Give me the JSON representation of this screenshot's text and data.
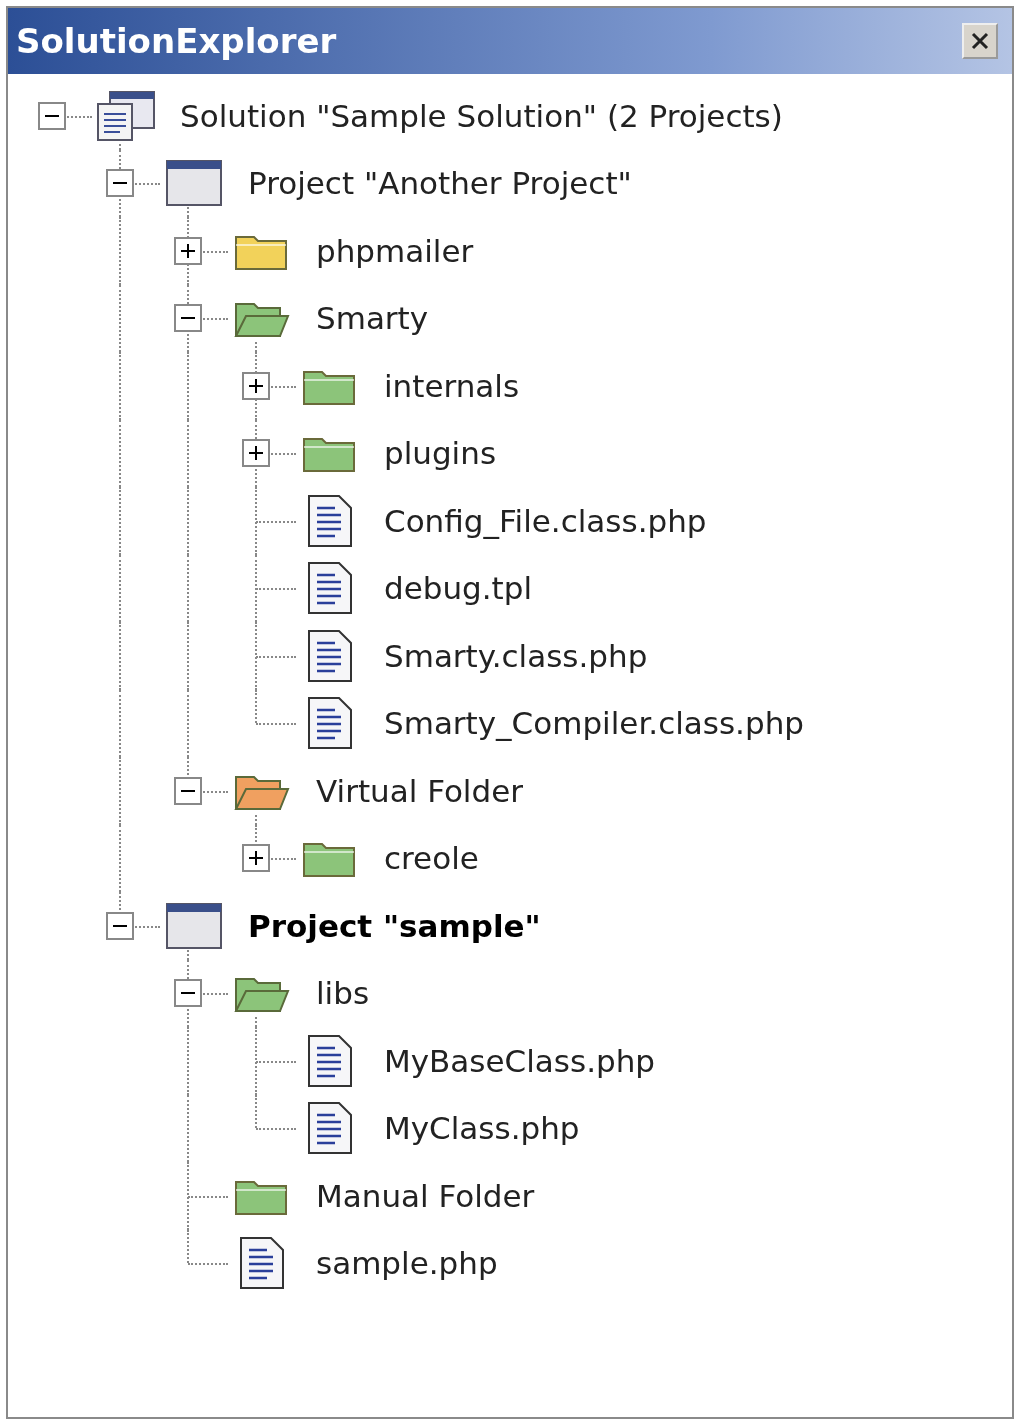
{
  "window": {
    "title": "SolutionExplorer"
  },
  "tree": [
    {
      "kind": "solution",
      "label": "Solution \"Sample Solution\" (2 Projects)",
      "expanded": true,
      "children": [
        {
          "kind": "project",
          "label": "Project \"Another Project\"",
          "active": false,
          "expanded": true,
          "children": [
            {
              "kind": "folder",
              "label": "phpmailer",
              "color": "#f2d25a",
              "expanded": false
            },
            {
              "kind": "folder",
              "label": "Smarty",
              "color": "#8cc47a",
              "expanded": true,
              "children": [
                {
                  "kind": "folder",
                  "label": "internals",
                  "color": "#8cc47a",
                  "expanded": false
                },
                {
                  "kind": "folder",
                  "label": "plugins",
                  "color": "#8cc47a",
                  "expanded": false
                },
                {
                  "kind": "file",
                  "label": "Config_File.class.php"
                },
                {
                  "kind": "file",
                  "label": "debug.tpl"
                },
                {
                  "kind": "file",
                  "label": "Smarty.class.php"
                },
                {
                  "kind": "file",
                  "label": "Smarty_Compiler.class.php"
                }
              ]
            },
            {
              "kind": "folder",
              "label": "Virtual Folder",
              "color": "#f0a060",
              "expanded": true,
              "children": [
                {
                  "kind": "folder",
                  "label": "creole",
                  "color": "#8cc47a",
                  "expanded": false
                }
              ]
            }
          ]
        },
        {
          "kind": "project",
          "label": "Project \"sample\"",
          "active": true,
          "expanded": true,
          "children": [
            {
              "kind": "folder",
              "label": "libs",
              "color": "#8cc47a",
              "expanded": true,
              "children": [
                {
                  "kind": "file",
                  "label": "MyBaseClass.php"
                },
                {
                  "kind": "file",
                  "label": "MyClass.php"
                }
              ]
            },
            {
              "kind": "folder",
              "label": "Manual Folder",
              "color": "#8cc47a"
            },
            {
              "kind": "file",
              "label": "sample.php"
            }
          ]
        }
      ]
    }
  ]
}
